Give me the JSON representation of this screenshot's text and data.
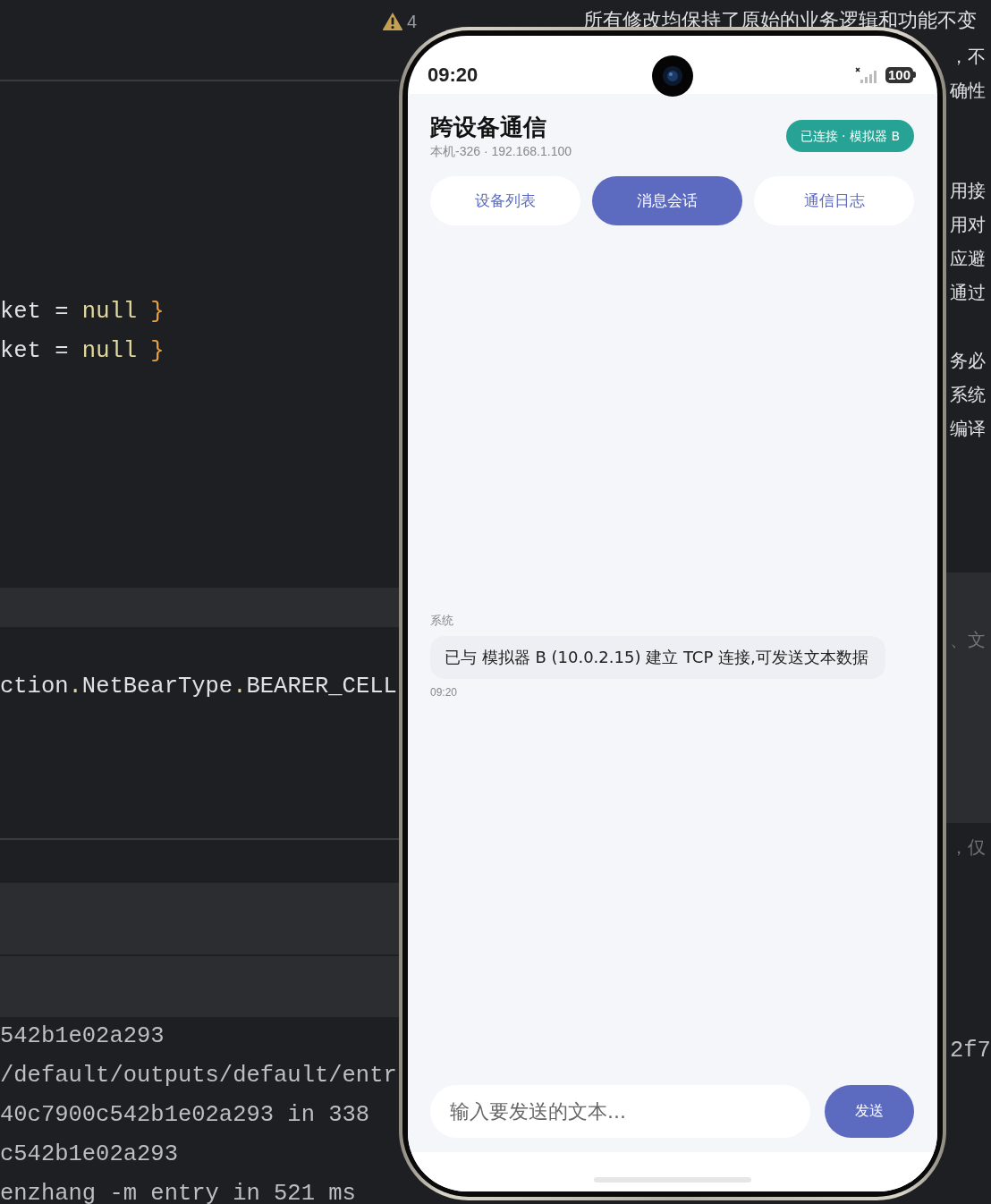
{
  "ide": {
    "warning_count": "4",
    "notice": "所有修改均保持了原始的业务逻辑和功能不变",
    "code_lines": [
      [
        {
          "text": "ket",
          "kind": "ident"
        },
        {
          "text": " = ",
          "kind": "op"
        },
        {
          "text": "null",
          "kind": "keyword"
        },
        {
          "text": " }",
          "kind": "brace"
        }
      ],
      [
        {
          "text": "ket",
          "kind": "ident"
        },
        {
          "text": " = ",
          "kind": "op"
        },
        {
          "text": "null",
          "kind": "keyword"
        },
        {
          "text": " }",
          "kind": "brace"
        }
      ],
      [
        {
          "text": "ction",
          "kind": "ident"
        },
        {
          "text": ".",
          "kind": "dot"
        },
        {
          "text": "NetBearType",
          "kind": "ident"
        },
        {
          "text": ".",
          "kind": "dot"
        },
        {
          "text": "BEARER_CELL",
          "kind": "ident"
        }
      ]
    ],
    "terminal_lines": [
      "542b1e02a293",
      "/default/outputs/default/entr",
      "40c7900c542b1e02a293 in 338",
      "c542b1e02a293",
      "enzhang -m entry in 521 ms"
    ],
    "side_paragraphs": [
      [
        "，不",
        "确性"
      ],
      [
        "用接",
        "用对",
        "应避",
        "通过"
      ],
      [
        "务必",
        "系统",
        "编译"
      ]
    ],
    "side_hints": [
      "、文",
      "，仅"
    ],
    "side_terminal": "2f7"
  },
  "phone": {
    "status_bar": {
      "time": "09:20",
      "battery": "100"
    },
    "app": {
      "title": "跨设备通信",
      "subtitle": "本机-326 · 192.168.1.100",
      "connection": {
        "label": "已连接 · 模拟器 B",
        "connected": true
      },
      "tabs": [
        {
          "label": "设备列表",
          "selected": false
        },
        {
          "label": "消息会话",
          "selected": true
        },
        {
          "label": "通信日志",
          "selected": false
        }
      ],
      "messages": [
        {
          "kind": "system",
          "sender": "系统",
          "text": "已与 模拟器 B (10.0.2.15) 建立 TCP 连接,可发送文本数据",
          "time": "09:20"
        }
      ],
      "composer": {
        "placeholder": "输入要发送的文本...",
        "send_label": "发送"
      }
    }
  }
}
